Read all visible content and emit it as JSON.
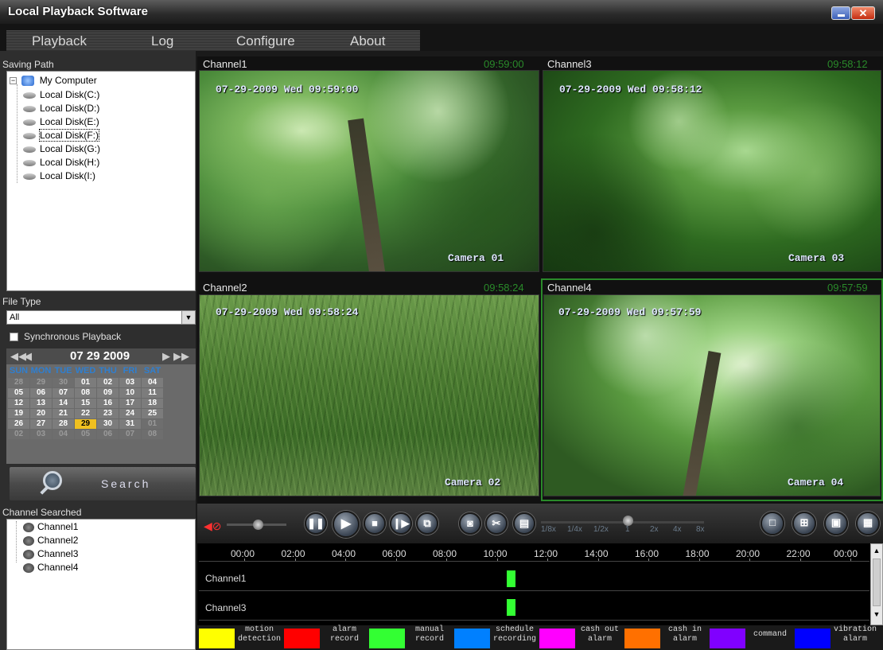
{
  "window": {
    "title": "Local Playback Software"
  },
  "menu": [
    "Playback",
    "Log",
    "Configure",
    "About"
  ],
  "left": {
    "saving_path_label": "Saving Path",
    "tree_root": "My Computer",
    "disks": [
      "Local Disk(C:)",
      "Local Disk(D:)",
      "Local Disk(E:)",
      "Local Disk(F:)",
      "Local Disk(G:)",
      "Local Disk(H:)",
      "Local Disk(I:)"
    ],
    "file_type_label": "File Type",
    "file_type_value": "All",
    "sync_label": "Synchronous Playback",
    "calendar": {
      "header": "07 29 2009",
      "days": [
        "SUN",
        "MON",
        "TUE",
        "WED",
        "THU",
        "FRI",
        "SAT"
      ],
      "weeks": [
        [
          "28",
          "29",
          "30",
          "01",
          "02",
          "03",
          "04"
        ],
        [
          "05",
          "06",
          "07",
          "08",
          "09",
          "10",
          "11"
        ],
        [
          "12",
          "13",
          "14",
          "15",
          "16",
          "17",
          "18"
        ],
        [
          "19",
          "20",
          "21",
          "22",
          "23",
          "24",
          "25"
        ],
        [
          "26",
          "27",
          "28",
          "29",
          "30",
          "31",
          "01"
        ],
        [
          "02",
          "03",
          "04",
          "05",
          "06",
          "07",
          "08"
        ]
      ],
      "selected": "29"
    },
    "search_label": "Search",
    "channel_searched_label": "Channel Searched",
    "channels": [
      "Channel1",
      "Channel2",
      "Channel3",
      "Channel4"
    ]
  },
  "videos": [
    {
      "title": "Channel1",
      "time": "09:59:00",
      "osd": "07-29-2009 Wed 09:59:00",
      "camera": "Camera 01"
    },
    {
      "title": "Channel3",
      "time": "09:58:12",
      "osd": "07-29-2009 Wed 09:58:12",
      "camera": "Camera 03"
    },
    {
      "title": "Channel2",
      "time": "09:58:24",
      "osd": "07-29-2009 Wed 09:58:24",
      "camera": "Camera 02"
    },
    {
      "title": "Channel4",
      "time": "09:57:59",
      "osd": "07-29-2009 Wed 09:57:59",
      "camera": "Camera 04"
    }
  ],
  "speeds": [
    "1/8x",
    "1/4x",
    "1/2x",
    "1",
    "2x",
    "4x",
    "8x"
  ],
  "timeline": {
    "hours": [
      "00:00",
      "02:00",
      "04:00",
      "06:00",
      "08:00",
      "10:00",
      "12:00",
      "14:00",
      "16:00",
      "18:00",
      "20:00",
      "22:00",
      "00:00"
    ],
    "rows": [
      "Channel1",
      "Channel3"
    ]
  },
  "legend": [
    {
      "label1": "motion",
      "label2": "detection",
      "color": "#ffff00"
    },
    {
      "label1": "alarm",
      "label2": "record",
      "color": "#ff0000"
    },
    {
      "label1": "manual",
      "label2": "record",
      "color": "#33ff33"
    },
    {
      "label1": "schedule",
      "label2": "recording",
      "color": "#0080ff"
    },
    {
      "label1": "cash out",
      "label2": "alarm",
      "color": "#ff00ff"
    },
    {
      "label1": "cash in",
      "label2": "alarm",
      "color": "#ff7000"
    },
    {
      "label1": "",
      "label2": "command",
      "color": "#8000ff"
    },
    {
      "label1": "vibration",
      "label2": "alarm",
      "color": "#0000ff"
    }
  ]
}
